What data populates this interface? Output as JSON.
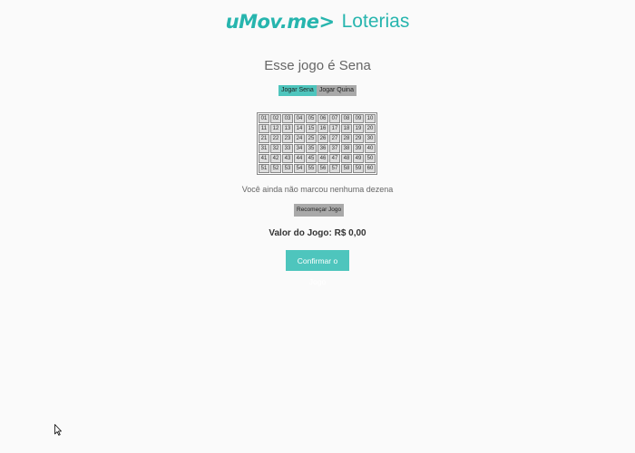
{
  "header": {
    "logo_text": "uMov.me",
    "logo_arrow": ">",
    "title": "Loterias"
  },
  "game": {
    "title": "Esse jogo é Sena",
    "tabs": [
      {
        "label": "Jogar Sena",
        "active": true
      },
      {
        "label": "Jogar Quina",
        "active": false
      }
    ],
    "numbers": [
      [
        "01",
        "02",
        "03",
        "04",
        "05",
        "06",
        "07",
        "08",
        "09",
        "10"
      ],
      [
        "11",
        "12",
        "13",
        "14",
        "15",
        "16",
        "17",
        "18",
        "19",
        "20"
      ],
      [
        "21",
        "22",
        "23",
        "24",
        "25",
        "26",
        "27",
        "28",
        "29",
        "30"
      ],
      [
        "31",
        "32",
        "33",
        "34",
        "35",
        "36",
        "37",
        "38",
        "39",
        "40"
      ],
      [
        "41",
        "42",
        "43",
        "44",
        "45",
        "46",
        "47",
        "48",
        "49",
        "50"
      ],
      [
        "51",
        "52",
        "53",
        "54",
        "55",
        "56",
        "57",
        "58",
        "59",
        "60"
      ]
    ],
    "status": "Você ainda não marcou nenhuma dezena",
    "restart_label": "Recomeçar Jogo",
    "value_label": "Valor do Jogo:",
    "value_amount": "R$ 0,00",
    "confirm_label": "Confirmar o Jogo"
  },
  "colors": {
    "brand": "#27b5ae",
    "accent": "#4ec5bd",
    "button_gray": "#a9a9a9",
    "cell_bg": "#dcdcdc"
  },
  "icons": {
    "cursor": "mouse-pointer-icon"
  }
}
